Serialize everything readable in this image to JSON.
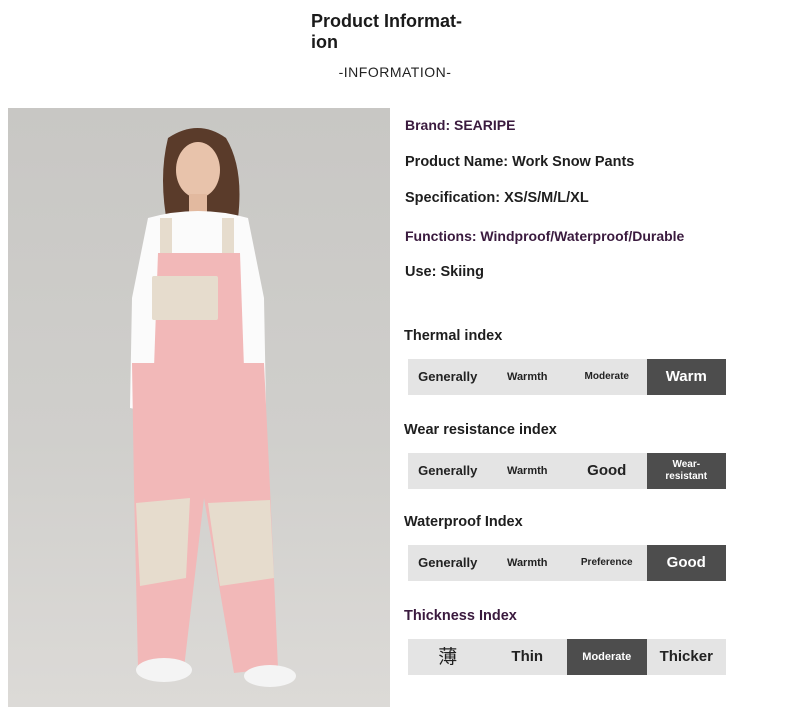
{
  "header": {
    "title": "Product Informat-\nion",
    "subtitle": "-INFORMATION-"
  },
  "info": {
    "brand": "Brand: SEARIPE",
    "product_name": "Product Name: Work Snow Pants",
    "specification": "Specification: XS/S/M/L/XL",
    "functions": "Functions: Windproof/Waterproof/Durable",
    "use": "Use: Skiing"
  },
  "indexes": [
    {
      "title": "Thermal index",
      "cells": [
        "Generally",
        "Warmth",
        "Moderate",
        "Warm"
      ],
      "active": 3
    },
    {
      "title": "Wear resistance index",
      "cells": [
        "Generally",
        "Warmth",
        "Good",
        "Wear-\nresistant"
      ],
      "active": 3
    },
    {
      "title": "Waterproof Index",
      "cells": [
        "Generally",
        "Warmth",
        "Preference",
        "Good"
      ],
      "active": 3
    },
    {
      "title": "Thickness Index",
      "cells": [
        "薄",
        "Thin",
        "Moderate",
        "Thicker"
      ],
      "active": 2
    }
  ],
  "colors": {
    "active_cell": "#4d4d4d",
    "inactive_bar": "#e4e4e4",
    "pants_pink": "#f2b8b8",
    "pants_beige": "#e6dccd"
  }
}
